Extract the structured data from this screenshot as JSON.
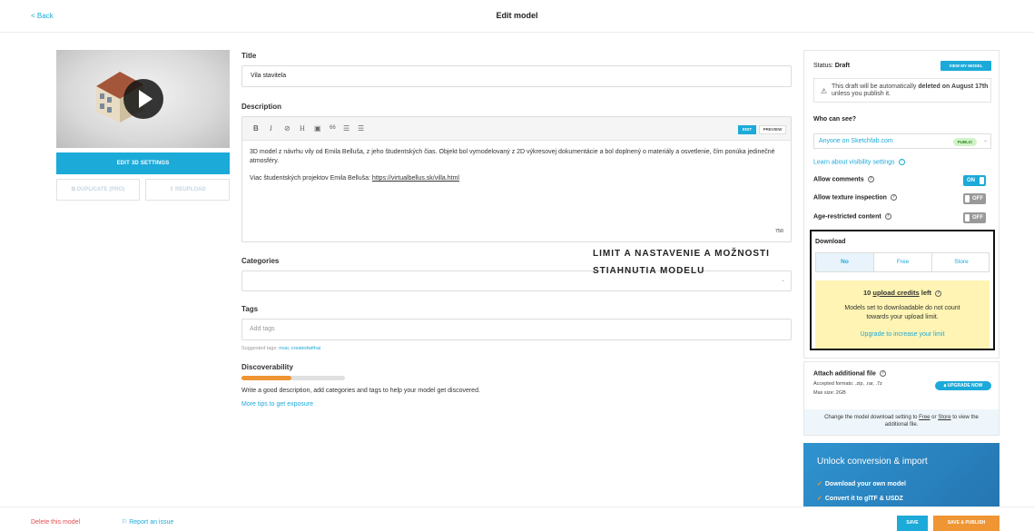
{
  "header": {
    "back": "< Back",
    "title": "Edit model"
  },
  "left": {
    "edit_3d": "EDIT 3D SETTINGS",
    "duplicate": "DUPLICATE (PRO)",
    "reupload": "REUPLOAD"
  },
  "form": {
    "title_label": "Title",
    "title_value": "Vila stavitela",
    "description_label": "Description",
    "editor_edit": "EDIT",
    "editor_preview": "PREVIEW",
    "description_p1": "3D model z návrhu vily od Emila Belluša, z jeho študentských čias. Objekt bol vymodelovaný z 2D výkresovej dokumentácie a bol doplnený o materiály a osvetlenie, čím ponúka jedinečné atmosféry.",
    "description_p2_prefix": "Viac študentských projektov Emila Belluša: ",
    "description_link": "https://virtualbellus.sk/villa.html",
    "char_count": "750",
    "categories_label": "Categories",
    "tags_label": "Tags",
    "tags_placeholder": "Add tags",
    "suggested_prefix": "Suggested tags: ",
    "suggested_tags": "noai, createdwithai",
    "discoverability_label": "Discoverability",
    "discoverability_level": 0.48,
    "discoverability_text": "Write a good description, add categories and tags to help your model get discovered.",
    "discoverability_link": "More tips to get exposure"
  },
  "annotation": {
    "line1": "LIMIT A NASTAVENIE A MOŽNOSTI",
    "line2": "STIAHNUTIA MODELU"
  },
  "status": {
    "label": "Status: ",
    "value": "Draft",
    "view_button": "VIEW MY MODEL",
    "draft_pre": "This draft will be automatically ",
    "draft_bold": "deleted on August 17th",
    "draft_post": " unless you publish it."
  },
  "visibility": {
    "title": "Who can see?",
    "value": "Anyone on Sketchfab.com",
    "badge": "PUBLIC",
    "learn": "Learn about visibility settings",
    "allow_comments": "Allow comments",
    "allow_comments_state": "ON",
    "allow_texture": "Allow texture inspection",
    "allow_texture_state": "OFF",
    "age_restricted": "Age-restricted content",
    "age_restricted_state": "OFF"
  },
  "download": {
    "title": "Download",
    "tabs": [
      "No",
      "Free",
      "Store"
    ],
    "selected": "No",
    "credits_num": "10",
    "credits_link": "upload credits",
    "credits_suffix": " left",
    "credits_note": "Models set to downloadable do not count towards your upload limit.",
    "upgrade_link": "Upgrade to increase your limit"
  },
  "attach": {
    "title": "Attach additional file",
    "formats": "Accepted formats: .zip, .rar, .7z",
    "max_size": "Max size: 2GB",
    "upgrade_button": "UPGRADE NOW",
    "foot_pre": "Change the model download setting to ",
    "foot_free": "Free",
    "foot_or": " or ",
    "foot_store": "Store",
    "foot_post": " to view the additional file."
  },
  "unlock": {
    "title": "Unlock conversion & import",
    "items": [
      "Download your own model",
      "Convert it to glTF & USDZ"
    ]
  },
  "footer": {
    "delete": "Delete this model",
    "report": "Report an issue",
    "save": "SAVE",
    "save_publish": "SAVE & PUBLISH"
  },
  "colors": {
    "accent": "#1caad9",
    "orange": "#ef9534",
    "danger": "#e54d4d",
    "credits_bg": "#fff4b3"
  }
}
